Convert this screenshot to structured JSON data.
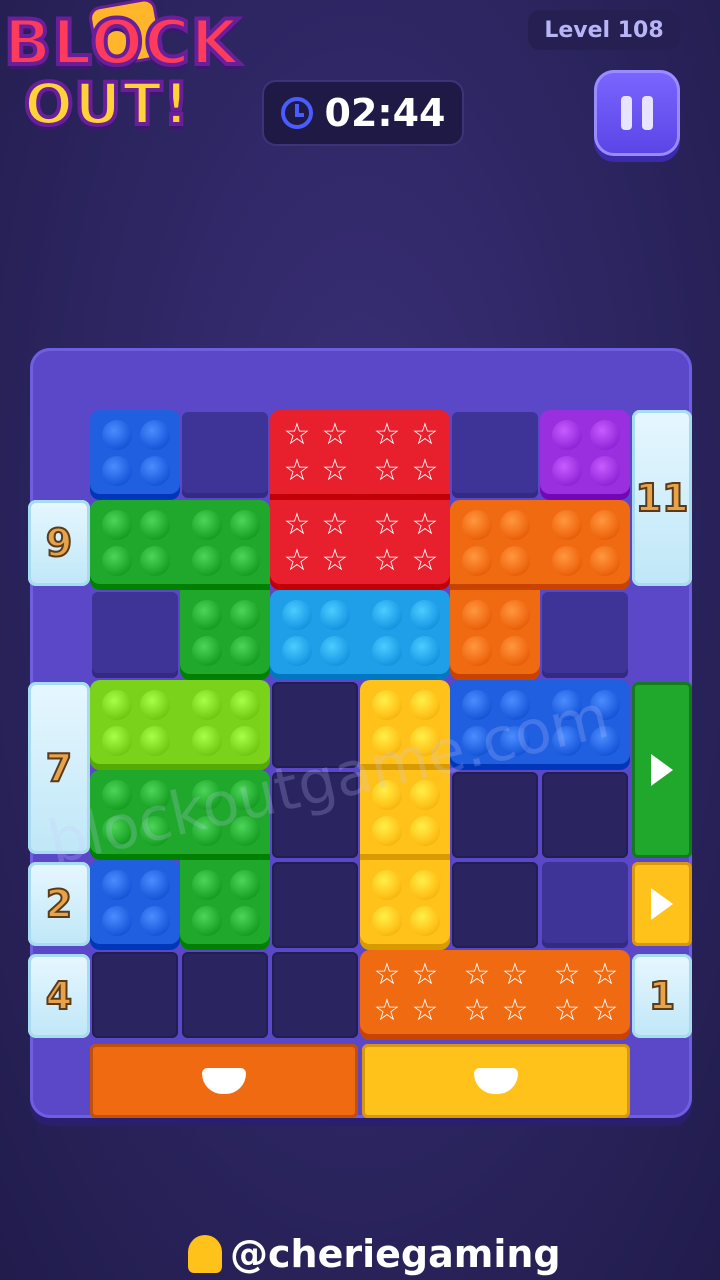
{
  "header": {
    "logo_line1": "BLOCK",
    "logo_line2": "OUT!",
    "level_label": "Level 108",
    "timer_value": "02:44"
  },
  "board": {
    "exits": {
      "left_9": "9",
      "left_7": "7",
      "left_2": "2",
      "left_4": "4",
      "right_11": "11",
      "right_1": "1"
    }
  },
  "watermark": "blockoutgame.com",
  "footer": {
    "handle": "@cheriegaming"
  },
  "colors": {
    "red": "#e8202e",
    "blue": "#1f5fe0",
    "light_blue": "#1f9fe8",
    "green": "#1fa82b",
    "lime": "#7bd21a",
    "orange": "#f06a12",
    "yellow": "#ffc21a",
    "purple": "#9a2fe0"
  }
}
